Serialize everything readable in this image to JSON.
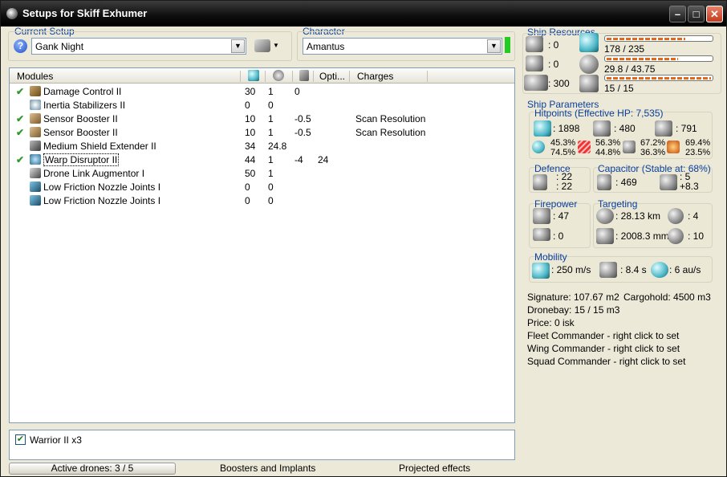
{
  "window": {
    "title": "Setups for Skiff Exhumer"
  },
  "setup": {
    "label": "Current Setup",
    "value": "Gank Night"
  },
  "character": {
    "label": "Character",
    "value": "Amantus"
  },
  "modules": {
    "headers": {
      "name": "Modules",
      "opt": "Opti...",
      "charges": "Charges"
    },
    "rows": [
      {
        "check": "✔",
        "name": "Damage Control II",
        "c1": "30",
        "c2": "1",
        "c3": "0",
        "c4": "",
        "charge": ""
      },
      {
        "check": "",
        "name": "Inertia Stabilizers II",
        "c1": "0",
        "c2": "0",
        "c3": "",
        "c4": "",
        "charge": ""
      },
      {
        "check": "✔",
        "name": "Sensor Booster II",
        "c1": "10",
        "c2": "1",
        "c3": "-0.5",
        "c4": "",
        "charge": "Scan Resolution"
      },
      {
        "check": "✔",
        "name": "Sensor Booster II",
        "c1": "10",
        "c2": "1",
        "c3": "-0.5",
        "c4": "",
        "charge": "Scan Resolution"
      },
      {
        "check": "",
        "name": "Medium Shield Extender II",
        "c1": "34",
        "c2": "24.8",
        "c3": "",
        "c4": "",
        "charge": ""
      },
      {
        "check": "✔",
        "name": "Warp Disruptor II",
        "c1": "44",
        "c2": "1",
        "c3": "-4",
        "c4": "24",
        "charge": ""
      },
      {
        "check": "",
        "name": "Drone Link Augmentor I",
        "c1": "50",
        "c2": "1",
        "c3": "",
        "c4": "",
        "charge": ""
      },
      {
        "check": "",
        "name": "Low Friction Nozzle Joints I",
        "c1": "0",
        "c2": "0",
        "c3": "",
        "c4": "",
        "charge": ""
      },
      {
        "check": "",
        "name": "Low Friction Nozzle Joints I",
        "c1": "0",
        "c2": "0",
        "c3": "",
        "c4": "",
        "charge": ""
      }
    ]
  },
  "drones": {
    "item": "Warrior II x3",
    "checked": true
  },
  "status": {
    "active_drones": "Active drones: 3 / 5",
    "boosters": "Boosters and Implants",
    "projected": "Projected effects"
  },
  "resources": {
    "title": "Ship Resources",
    "turret": ": 0",
    "launcher": ": 0",
    "drone_bay": ": 300",
    "cpu": "178 / 235",
    "cpu_frac": 0.757,
    "power": "29.8 / 43.75",
    "power_frac": 0.681,
    "bandwidth": "15 / 15",
    "bandwidth_frac": 1.0
  },
  "params": {
    "title": "Ship Parameters",
    "hitpoints_title": "Hitpoints (Effective HP: 7,535)",
    "shield_hp": ": 1898",
    "armor_hp": ": 480",
    "hull_hp": ": 791",
    "res": {
      "s1": "45.3%",
      "s2": "74.5%",
      "a1": "56.3%",
      "a2": "44.8%",
      "k1": "67.2%",
      "k2": "36.3%",
      "e1": "69.4%",
      "e2": "23.5%"
    },
    "defence_title": "Defence",
    "def1": ": 22",
    "def2": ": 22",
    "capacitor_title": "Capacitor (Stable at: 68%)",
    "cap1": ": 469",
    "cap2": ": 5",
    "cap3": "+8.3",
    "firepower_title": "Firepower",
    "fp1": ": 47",
    "fp2": ": 0",
    "targeting_title": "Targeting",
    "tg_range": ": 28.13 km",
    "tg_targets": ": 4",
    "tg_scan": ": 2008.3 mm",
    "tg_sensor": ": 10",
    "mobility_title": "Mobility",
    "speed": ": 250 m/s",
    "align": ": 8.4 s",
    "warp": ": 6 au/s"
  },
  "misc": {
    "signature": "Signature: 107.67 m2",
    "cargohold": "Cargohold: 4500 m3",
    "dronebay": "Dronebay: 15 / 15 m3",
    "price": "Price: 0 isk",
    "fleet": "Fleet Commander - right click to set",
    "wing": "Wing Commander - right click to set",
    "squad": "Squad Commander - right click to set"
  }
}
